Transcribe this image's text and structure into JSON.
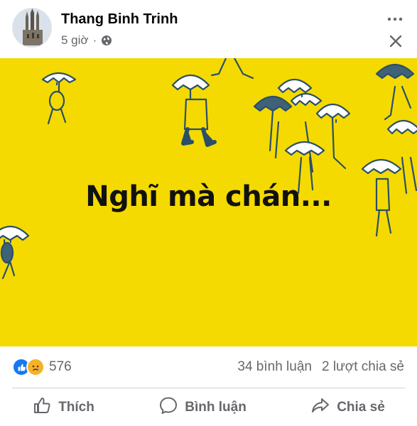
{
  "post": {
    "author_name": "Thang Binh Trinh",
    "time": "5 giờ",
    "separator": "·",
    "privacy_icon": "globe-icon",
    "image_text": "Nghĩ mà chán..."
  },
  "reactions": {
    "types": [
      "like",
      "sad"
    ],
    "count": "576"
  },
  "stats": {
    "comments": "34 bình luận",
    "shares": "2 lượt chia sẻ"
  },
  "actions": {
    "like_label": "Thích",
    "comment_label": "Bình luận",
    "share_label": "Chia sẻ"
  },
  "colors": {
    "image_background": "#f4da00",
    "like_blue": "#1877f2",
    "sad_yellow": "#f7b125",
    "secondary_text": "#65676b"
  }
}
